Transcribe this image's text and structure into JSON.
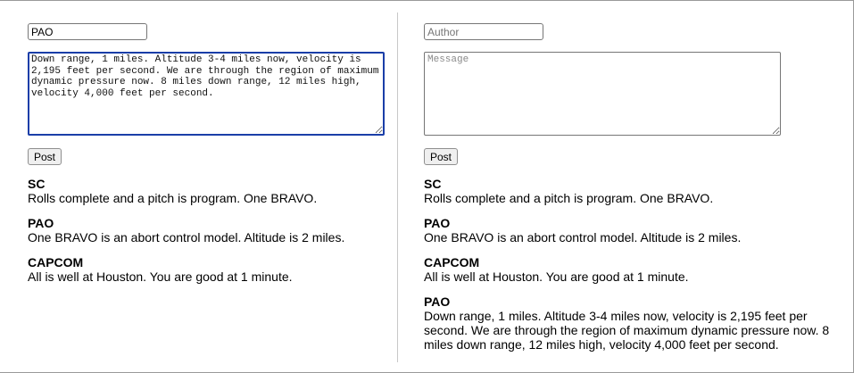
{
  "left_pane": {
    "author_value": "PAO",
    "message_value": "Down range, 1 miles. Altitude 3-4 miles now, velocity is 2,195 feet per second. We are through the region of maximum dynamic pressure now. 8 miles down range, 12 miles high, velocity 4,000 feet per second.",
    "post_label": "Post",
    "messages": [
      {
        "author": "SC",
        "text": "Rolls complete and a pitch is program. One BRAVO."
      },
      {
        "author": "PAO",
        "text": "One BRAVO is an abort control model. Altitude is 2 miles."
      },
      {
        "author": "CAPCOM",
        "text": "All is well at Houston. You are good at 1 minute."
      }
    ]
  },
  "right_pane": {
    "author_placeholder": "Author",
    "message_placeholder": "Message",
    "post_label": "Post",
    "messages": [
      {
        "author": "SC",
        "text": "Rolls complete and a pitch is program. One BRAVO."
      },
      {
        "author": "PAO",
        "text": "One BRAVO is an abort control model. Altitude is 2 miles."
      },
      {
        "author": "CAPCOM",
        "text": "All is well at Houston. You are good at 1 minute."
      },
      {
        "author": "PAO",
        "text": "Down range, 1 miles. Altitude 3-4 miles now, velocity is 2,195 feet per second. We are through the region of maximum dynamic pressure now. 8 miles down range, 12 miles high, velocity 4,000 feet per second."
      }
    ]
  },
  "colors": {
    "focus_ring": "#1a3ea8",
    "divider": "#c8c8c8"
  }
}
